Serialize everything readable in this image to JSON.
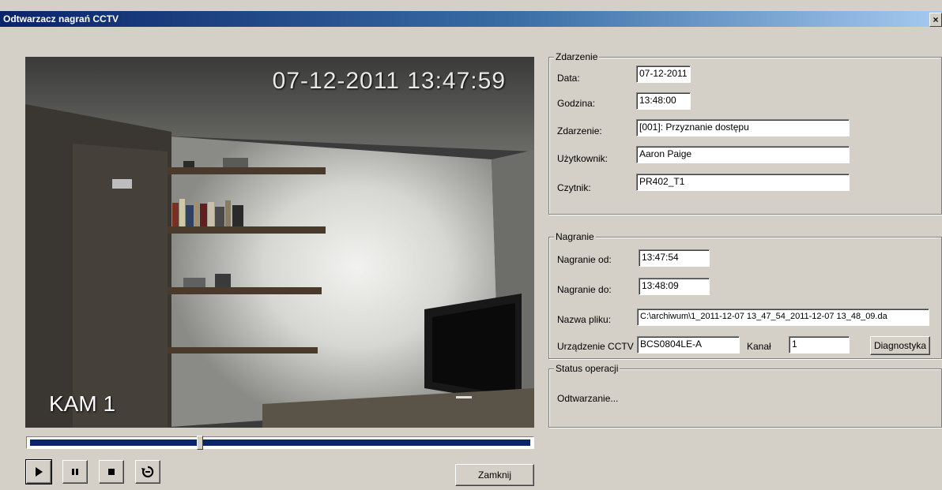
{
  "window": {
    "title": "Odtwarzacz nagrań CCTV",
    "close_glyph": "×"
  },
  "video": {
    "timestamp": "07-12-2011  13:47:59",
    "camera_label": "KAM 1"
  },
  "playback": {
    "position_fraction": 0.34
  },
  "controls": {
    "play_icon": "play-icon",
    "pause_icon": "pause-icon",
    "stop_icon": "stop-icon",
    "loop_icon": "loop-icon",
    "close_label": "Zamknij"
  },
  "event": {
    "title": "Zdarzenie",
    "date_label": "Data:",
    "date_value": "07-12-2011",
    "time_label": "Godzina:",
    "time_value": "13:48:00",
    "event_label": "Zdarzenie:",
    "event_value": "[001]: Przyznanie dostępu",
    "user_label": "Użytkownik:",
    "user_value": "Aaron Paige",
    "reader_label": "Czytnik:",
    "reader_value": "PR402_T1"
  },
  "recording": {
    "title": "Nagranie",
    "from_label": "Nagranie od:",
    "from_value": "13:47:54",
    "to_label": "Nagranie do:",
    "to_value": "13:48:09",
    "filename_label": "Nazwa pliku:",
    "filename_value": "C:\\archiwum\\1_2011-12-07 13_47_54_2011-12-07 13_48_09.da",
    "device_label": "Urządzenie CCTV",
    "device_value": "BCS0804LE-A",
    "channel_label": "Kanał",
    "channel_value": "1",
    "diagnostics_label": "Diagnostyka"
  },
  "status": {
    "title": "Status operacji",
    "text": "Odtwarzanie..."
  }
}
